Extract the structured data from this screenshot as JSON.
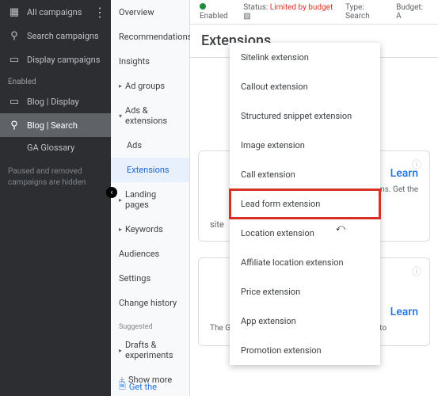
{
  "darkSidebar": {
    "allCampaigns": "All campaigns",
    "searchCampaigns": "Search campaigns",
    "displayCampaigns": "Display campaigns",
    "enabledLabel": "Enabled",
    "blogDisplay": "Blog | Display",
    "blogSearch": "Blog | Search",
    "gaGlossary": "GA Glossary",
    "hint": "Paused and removed campaigns are hidden"
  },
  "midNav": {
    "overview": "Overview",
    "recommendations": "Recommendations",
    "insights": "Insights",
    "adGroups": "Ad groups",
    "adsExtensions": "Ads & extensions",
    "ads": "Ads",
    "extensions": "Extensions",
    "landingPages": "Landing pages",
    "keywords": "Keywords",
    "audiences": "Audiences",
    "settings": "Settings",
    "changeHistory": "Change history",
    "suggestedLabel": "Suggested",
    "draftsExperiments": "Drafts & experiments",
    "showMore": "Show more"
  },
  "statusBar": {
    "enabled": "Enabled",
    "statusLabel": "Status:",
    "statusValue": "Limited by budget",
    "typeLabel": "Type:",
    "typeValue": "Search",
    "budgetLabel": "Budget:",
    "budgetValue": "A"
  },
  "main": {
    "heading": "Extensions"
  },
  "dropdown": {
    "sitelink": "Sitelink extension",
    "callout": "Callout extension",
    "structured": "Structured snippet extension",
    "image": "Image extension",
    "call": "Call extension",
    "leadForm": "Lead form extension",
    "location": "Location extension",
    "affiliateLocation": "Affiliate location extension",
    "price": "Price extension",
    "app": "App extension",
    "promotion": "Promotion extension"
  },
  "card1": {
    "learn": "Learn",
    "desc": "our reference to earn all of the rms. Get the",
    "site": "site"
  },
  "card2": {
    "learn": "Learn",
    "desc": "The Google Analytics Glossary is your reference to"
  },
  "footer": {
    "getThe": "Get the"
  }
}
